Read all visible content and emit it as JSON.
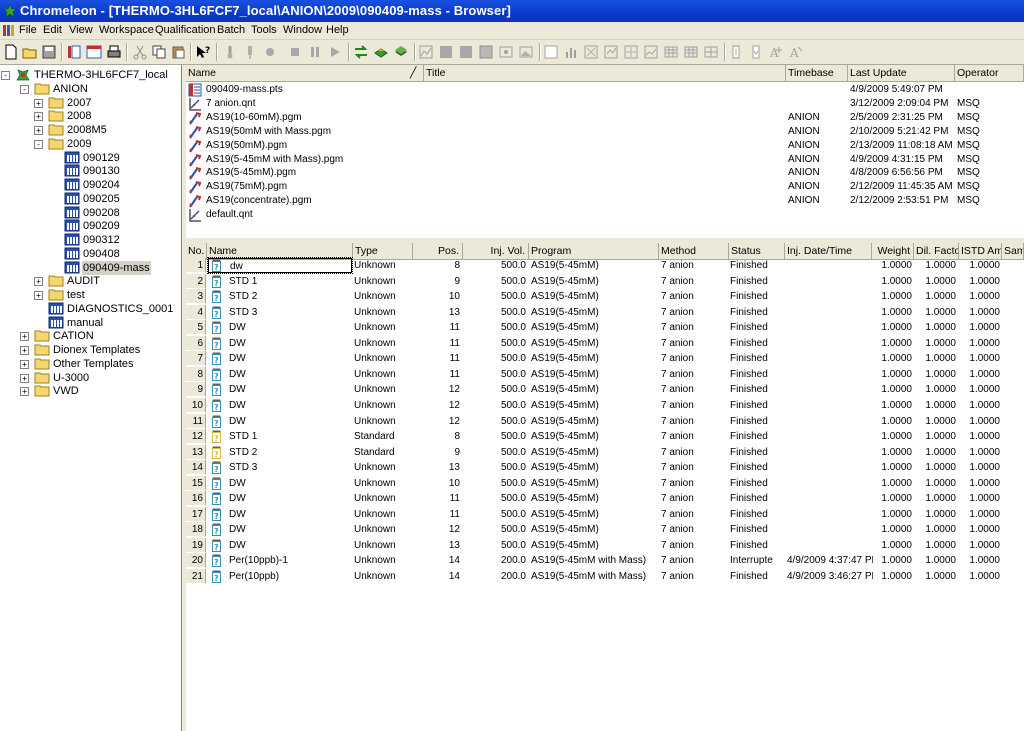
{
  "window": {
    "title": "Chromeleon - [THERMO-3HL6FCF7_local\\ANION\\2009\\090409-mass - Browser]"
  },
  "menu": [
    "File",
    "Edit",
    "View",
    "Workspace",
    "Qualification",
    "Batch",
    "Tools",
    "Window",
    "Help"
  ],
  "tree": {
    "nodes": [
      {
        "label": "THERMO-3HL6FCF7_local",
        "icon": "server-icon",
        "expander": "-"
      },
      {
        "label": "ANION",
        "icon": "folder-icon",
        "expander": "-"
      },
      {
        "label": "2007",
        "icon": "folder-icon",
        "expander": "+"
      },
      {
        "label": "2008",
        "icon": "folder-icon",
        "expander": "+"
      },
      {
        "label": "2008M5",
        "icon": "folder-icon",
        "expander": "+"
      },
      {
        "label": "2009",
        "icon": "folder-icon",
        "expander": "-"
      },
      {
        "label": "090129",
        "icon": "sequence-icon",
        "expander": ""
      },
      {
        "label": "090130",
        "icon": "sequence-icon",
        "expander": ""
      },
      {
        "label": "090204",
        "icon": "sequence-icon",
        "expander": ""
      },
      {
        "label": "090205",
        "icon": "sequence-icon",
        "expander": ""
      },
      {
        "label": "090208",
        "icon": "sequence-icon",
        "expander": ""
      },
      {
        "label": "090209",
        "icon": "sequence-icon",
        "expander": ""
      },
      {
        "label": "090312",
        "icon": "sequence-icon",
        "expander": ""
      },
      {
        "label": "090408",
        "icon": "sequence-icon",
        "expander": ""
      },
      {
        "label": "090409-mass",
        "icon": "sequence-icon",
        "expander": "",
        "selected": true
      },
      {
        "label": "AUDIT",
        "icon": "folder-icon",
        "expander": "+"
      },
      {
        "label": "test",
        "icon": "folder-icon",
        "expander": "+"
      },
      {
        "label": "DIAGNOSTICS_0001",
        "icon": "sequence-icon",
        "expander": ""
      },
      {
        "label": "manual",
        "icon": "sequence-icon",
        "expander": ""
      },
      {
        "label": "CATION",
        "icon": "folder-icon",
        "expander": "+"
      },
      {
        "label": "Dionex Templates",
        "icon": "folder-icon",
        "expander": "+"
      },
      {
        "label": "Other Templates",
        "icon": "folder-icon",
        "expander": "+"
      },
      {
        "label": "U-3000",
        "icon": "folder-icon",
        "expander": "+"
      },
      {
        "label": "VWD",
        "icon": "folder-icon",
        "expander": "+"
      }
    ]
  },
  "files": {
    "columns": [
      "Name",
      "Title",
      "Timebase",
      "Last Update",
      "Operator"
    ],
    "sort_indicator": "╱",
    "rows": [
      {
        "name": "090409-mass.pts",
        "icon": "report-icon",
        "title": "",
        "timebase": "",
        "last_update": "4/9/2009 5:49:07 PM",
        "operator": ""
      },
      {
        "name": "7 anion.qnt",
        "icon": "quantification-icon",
        "title": "",
        "timebase": "",
        "last_update": "3/12/2009 2:09:04 PM",
        "operator": "MSQ"
      },
      {
        "name": "AS19(10-60mM).pgm",
        "icon": "program-icon",
        "title": "",
        "timebase": "ANION",
        "last_update": "2/5/2009 2:31:25 PM",
        "operator": "MSQ"
      },
      {
        "name": "AS19(50mM with Mass.pgm",
        "icon": "program-icon",
        "title": "",
        "timebase": "ANION",
        "last_update": "2/10/2009 5:21:42 PM",
        "operator": "MSQ"
      },
      {
        "name": "AS19(50mM).pgm",
        "icon": "program-icon",
        "title": "",
        "timebase": "ANION",
        "last_update": "2/13/2009 11:08:18 AM",
        "operator": "MSQ"
      },
      {
        "name": "AS19(5-45mM with Mass).pgm",
        "icon": "program-icon",
        "title": "",
        "timebase": "ANION",
        "last_update": "4/9/2009 4:31:15 PM",
        "operator": "MSQ"
      },
      {
        "name": "AS19(5-45mM).pgm",
        "icon": "program-icon",
        "title": "",
        "timebase": "ANION",
        "last_update": "4/8/2009 6:56:56 PM",
        "operator": "MSQ"
      },
      {
        "name": "AS19(75mM).pgm",
        "icon": "program-icon",
        "title": "",
        "timebase": "ANION",
        "last_update": "2/12/2009 11:45:35 AM",
        "operator": "MSQ"
      },
      {
        "name": "AS19(concentrate).pgm",
        "icon": "program-icon",
        "title": "",
        "timebase": "ANION",
        "last_update": "2/12/2009 2:53:51 PM",
        "operator": "MSQ"
      },
      {
        "name": "default.qnt",
        "icon": "quantification-icon",
        "title": "",
        "timebase": "",
        "last_update": "",
        "operator": ""
      }
    ]
  },
  "samples": {
    "columns": [
      "No.",
      "Name",
      "Type",
      "Pos.",
      "Inj. Vol.",
      "Program",
      "Method",
      "Status",
      "Inj. Date/Time",
      "Weight",
      "Dil. Facto",
      "ISTD Am",
      "Samp"
    ],
    "rows": [
      {
        "no": "1",
        "name": "dw",
        "type": "Unknown",
        "pos": "8",
        "vol": "500.0",
        "program": "AS19(5-45mM)",
        "method": "7 anion",
        "status": "Finished",
        "datetime": "",
        "weight": "1.0000",
        "dil": "1.0000",
        "istd": "1.0000"
      },
      {
        "no": "2",
        "name": "STD 1",
        "type": "Unknown",
        "pos": "9",
        "vol": "500.0",
        "program": "AS19(5-45mM)",
        "method": "7 anion",
        "status": "Finished",
        "datetime": "",
        "weight": "1.0000",
        "dil": "1.0000",
        "istd": "1.0000"
      },
      {
        "no": "3",
        "name": "STD 2",
        "type": "Unknown",
        "pos": "10",
        "vol": "500.0",
        "program": "AS19(5-45mM)",
        "method": "7 anion",
        "status": "Finished",
        "datetime": "",
        "weight": "1.0000",
        "dil": "1.0000",
        "istd": "1.0000"
      },
      {
        "no": "4",
        "name": "STD 3",
        "type": "Unknown",
        "pos": "13",
        "vol": "500.0",
        "program": "AS19(5-45mM)",
        "method": "7 anion",
        "status": "Finished",
        "datetime": "",
        "weight": "1.0000",
        "dil": "1.0000",
        "istd": "1.0000"
      },
      {
        "no": "5",
        "name": "DW",
        "type": "Unknown",
        "pos": "11",
        "vol": "500.0",
        "program": "AS19(5-45mM)",
        "method": "7 anion",
        "status": "Finished",
        "datetime": "",
        "weight": "1.0000",
        "dil": "1.0000",
        "istd": "1.0000"
      },
      {
        "no": "6",
        "name": "DW",
        "type": "Unknown",
        "pos": "11",
        "vol": "500.0",
        "program": "AS19(5-45mM)",
        "method": "7 anion",
        "status": "Finished",
        "datetime": "",
        "weight": "1.0000",
        "dil": "1.0000",
        "istd": "1.0000"
      },
      {
        "no": "7",
        "name": "DW",
        "type": "Unknown",
        "pos": "11",
        "vol": "500.0",
        "program": "AS19(5-45mM)",
        "method": "7 anion",
        "status": "Finished",
        "datetime": "",
        "weight": "1.0000",
        "dil": "1.0000",
        "istd": "1.0000"
      },
      {
        "no": "8",
        "name": "DW",
        "type": "Unknown",
        "pos": "11",
        "vol": "500.0",
        "program": "AS19(5-45mM)",
        "method": "7 anion",
        "status": "Finished",
        "datetime": "",
        "weight": "1.0000",
        "dil": "1.0000",
        "istd": "1.0000"
      },
      {
        "no": "9",
        "name": "DW",
        "type": "Unknown",
        "pos": "12",
        "vol": "500.0",
        "program": "AS19(5-45mM)",
        "method": "7 anion",
        "status": "Finished",
        "datetime": "",
        "weight": "1.0000",
        "dil": "1.0000",
        "istd": "1.0000"
      },
      {
        "no": "10",
        "name": "DW",
        "type": "Unknown",
        "pos": "12",
        "vol": "500.0",
        "program": "AS19(5-45mM)",
        "method": "7 anion",
        "status": "Finished",
        "datetime": "",
        "weight": "1.0000",
        "dil": "1.0000",
        "istd": "1.0000"
      },
      {
        "no": "11",
        "name": "DW",
        "type": "Unknown",
        "pos": "12",
        "vol": "500.0",
        "program": "AS19(5-45mM)",
        "method": "7 anion",
        "status": "Finished",
        "datetime": "",
        "weight": "1.0000",
        "dil": "1.0000",
        "istd": "1.0000"
      },
      {
        "no": "12",
        "name": "STD 1",
        "type": "Standard",
        "pos": "8",
        "vol": "500.0",
        "program": "AS19(5-45mM)",
        "method": "7 anion",
        "status": "Finished",
        "datetime": "",
        "weight": "1.0000",
        "dil": "1.0000",
        "istd": "1.0000"
      },
      {
        "no": "13",
        "name": "STD 2",
        "type": "Standard",
        "pos": "9",
        "vol": "500.0",
        "program": "AS19(5-45mM)",
        "method": "7 anion",
        "status": "Finished",
        "datetime": "",
        "weight": "1.0000",
        "dil": "1.0000",
        "istd": "1.0000"
      },
      {
        "no": "14",
        "name": "STD 3",
        "type": "Unknown",
        "pos": "13",
        "vol": "500.0",
        "program": "AS19(5-45mM)",
        "method": "7 anion",
        "status": "Finished",
        "datetime": "",
        "weight": "1.0000",
        "dil": "1.0000",
        "istd": "1.0000"
      },
      {
        "no": "15",
        "name": "DW",
        "type": "Unknown",
        "pos": "10",
        "vol": "500.0",
        "program": "AS19(5-45mM)",
        "method": "7 anion",
        "status": "Finished",
        "datetime": "",
        "weight": "1.0000",
        "dil": "1.0000",
        "istd": "1.0000"
      },
      {
        "no": "16",
        "name": "DW",
        "type": "Unknown",
        "pos": "11",
        "vol": "500.0",
        "program": "AS19(5-45mM)",
        "method": "7 anion",
        "status": "Finished",
        "datetime": "",
        "weight": "1.0000",
        "dil": "1.0000",
        "istd": "1.0000"
      },
      {
        "no": "17",
        "name": "DW",
        "type": "Unknown",
        "pos": "11",
        "vol": "500.0",
        "program": "AS19(5-45mM)",
        "method": "7 anion",
        "status": "Finished",
        "datetime": "",
        "weight": "1.0000",
        "dil": "1.0000",
        "istd": "1.0000"
      },
      {
        "no": "18",
        "name": "DW",
        "type": "Unknown",
        "pos": "12",
        "vol": "500.0",
        "program": "AS19(5-45mM)",
        "method": "7 anion",
        "status": "Finished",
        "datetime": "",
        "weight": "1.0000",
        "dil": "1.0000",
        "istd": "1.0000"
      },
      {
        "no": "19",
        "name": "DW",
        "type": "Unknown",
        "pos": "13",
        "vol": "500.0",
        "program": "AS19(5-45mM)",
        "method": "7 anion",
        "status": "Finished",
        "datetime": "",
        "weight": "1.0000",
        "dil": "1.0000",
        "istd": "1.0000"
      },
      {
        "no": "20",
        "name": "Per(10ppb)-1",
        "type": "Unknown",
        "pos": "14",
        "vol": "200.0",
        "program": "AS19(5-45mM with Mass)",
        "method": "7 anion",
        "status": "Interrupte",
        "datetime": "4/9/2009 4:37:47 PM",
        "weight": "1.0000",
        "dil": "1.0000",
        "istd": "1.0000"
      },
      {
        "no": "21",
        "name": "Per(10ppb)",
        "type": "Unknown",
        "pos": "14",
        "vol": "200.0",
        "program": "AS19(5-45mM with Mass)",
        "method": "7 anion",
        "status": "Finished",
        "datetime": "4/9/2009 3:46:27 PM",
        "weight": "1.0000",
        "dil": "1.0000",
        "istd": "1.0000"
      }
    ]
  },
  "colors": {
    "titlebar": "#0a3acb",
    "chrome": "#ece9d8",
    "folder": "#f5d76e",
    "vial_unknown": "#3a8fb0",
    "vial_standard": "#d4b84a"
  }
}
